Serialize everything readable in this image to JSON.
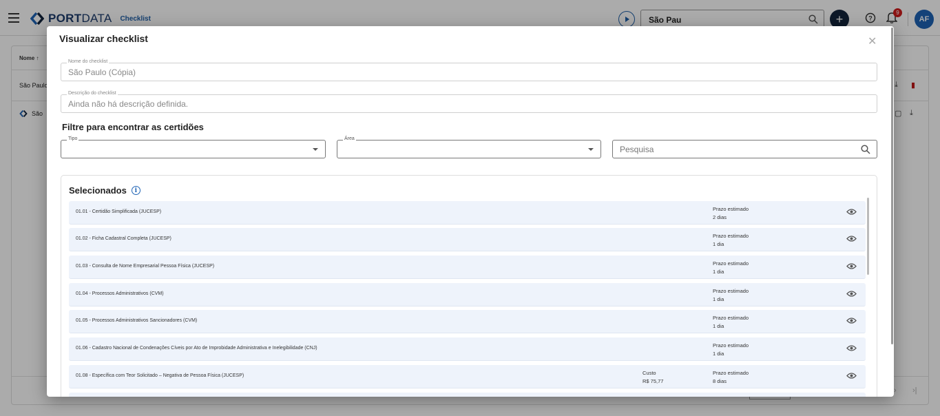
{
  "header": {
    "brand_bold": "PORT",
    "brand_light": "DATA",
    "section": "Checklist",
    "search_value": "São Pau",
    "notifications_count": "9",
    "avatar_initials": "AF"
  },
  "background": {
    "column_header": "Nome ↑",
    "row_1": "São Paulo",
    "row_2": "São"
  },
  "modal": {
    "title": "Visualizar checklist",
    "name_label": "Nome do checklist",
    "name_value": "São Paulo (Cópia)",
    "desc_label": "Descrição do checklist",
    "desc_value": "Ainda não há descrição definida.",
    "filter_heading": "Filtre para encontrar as certidões",
    "tipo_label": "Tipo",
    "area_label": "Área",
    "search_placeholder": "Pesquisa",
    "selected_heading": "Selecionados",
    "items": [
      {
        "name": "01.01 - Certidão Simplificada (JUCESP)",
        "prazo_label": "Prazo estimado",
        "prazo": "2 dias",
        "cost_label": "",
        "cost": ""
      },
      {
        "name": "01.02 - Ficha Cadastral Completa (JUCESP)",
        "prazo_label": "Prazo estimado",
        "prazo": "1 dia",
        "cost_label": "",
        "cost": ""
      },
      {
        "name": "01.03 - Consulta de Nome Empresarial Pessoa Física (JUCESP)",
        "prazo_label": "Prazo estimado",
        "prazo": "1 dia",
        "cost_label": "",
        "cost": ""
      },
      {
        "name": "01.04 - Processos Administrativos (CVM)",
        "prazo_label": "Prazo estimado",
        "prazo": "1 dia",
        "cost_label": "",
        "cost": ""
      },
      {
        "name": "01.05 - Processos Administrativos Sancionadores (CVM)",
        "prazo_label": "Prazo estimado",
        "prazo": "1 dia",
        "cost_label": "",
        "cost": ""
      },
      {
        "name": "01.06 - Cadastro Nacional de Condenações Cíveis por Ato de Improbidade Administrativa e Inelegibilidade (CNJ)",
        "prazo_label": "Prazo estimado",
        "prazo": "1 dia",
        "cost_label": "",
        "cost": ""
      },
      {
        "name": "01.08 - Específica com Teor Solicitado – Negativa de Pessoa Física (JUCESP)",
        "prazo_label": "Prazo estimado",
        "prazo": "8 dias",
        "cost_label": "Custo",
        "cost": "R$ 75,77"
      }
    ]
  },
  "colors": {
    "brand_blue": "#1e63b5",
    "navy": "#13243d",
    "item_bg": "#eef3fb",
    "alert_red": "#d01c1c"
  }
}
